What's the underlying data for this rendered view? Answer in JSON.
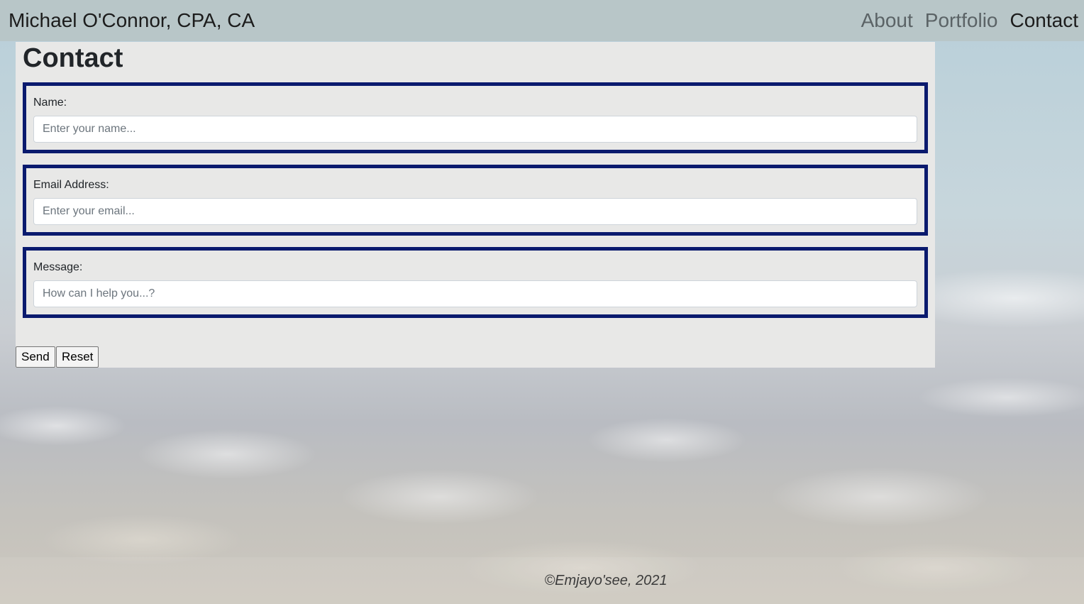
{
  "navbar": {
    "brand": "Michael O'Connor, CPA, CA",
    "links": [
      {
        "label": "About",
        "active": false
      },
      {
        "label": "Portfolio",
        "active": false
      },
      {
        "label": "Contact",
        "active": true
      }
    ]
  },
  "contact": {
    "title": "Contact",
    "fields": [
      {
        "label": "Name:",
        "placeholder": "Enter your name...",
        "value": ""
      },
      {
        "label": "Email Address:",
        "placeholder": "Enter your email...",
        "value": ""
      },
      {
        "label": "Message:",
        "placeholder": "How can I help you...?",
        "value": ""
      }
    ],
    "send_label": "Send",
    "reset_label": "Reset"
  },
  "footer": {
    "copyright": "©Emjayo'see, 2021"
  },
  "colors": {
    "navbar_bg": "#b8c6c8",
    "panel_bg": "#e8e8e7",
    "field_border": "#0a1a6e",
    "active_link": "#1c1c1c",
    "inactive_link": "#5b6366"
  }
}
